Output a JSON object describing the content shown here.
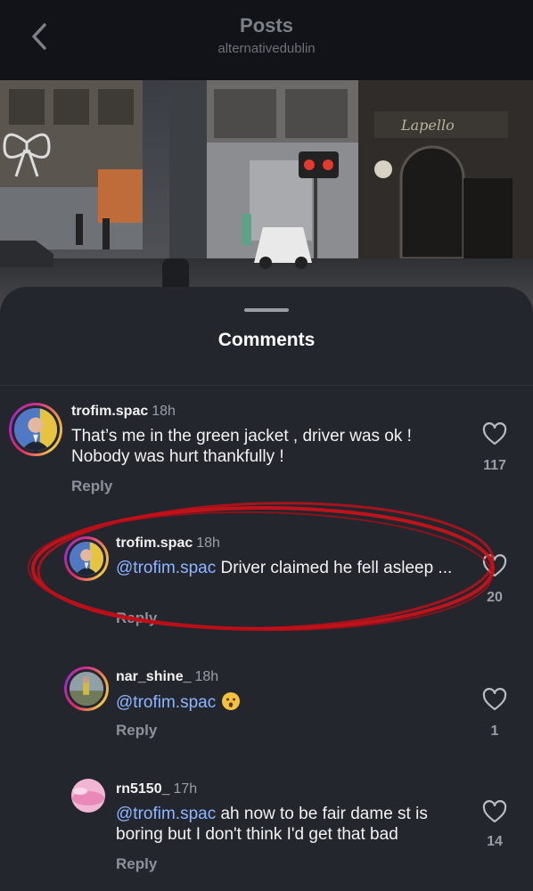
{
  "header": {
    "title": "Posts",
    "subtitle": "alternativedublin"
  },
  "photo": {
    "shop_sign": "Lapello"
  },
  "sheet": {
    "title": "Comments"
  },
  "comments": [
    {
      "username": "trofim.spac",
      "time": "18h",
      "text": "That’s me in the green jacket , driver was ok ! Nobody was hurt thankfully !",
      "mention": "",
      "reply_label": "Reply",
      "likes": "117"
    },
    {
      "username": "trofim.spac",
      "time": "18h",
      "mention": "@trofim.spac",
      "text": " Driver claimed he fell asleep ...",
      "reply_label": "Reply",
      "likes": "20"
    },
    {
      "username": "nar_shine_",
      "time": "18h",
      "mention": "@trofim.spac",
      "text": "",
      "emoji": "hushed-face-emoji",
      "reply_label": "Reply",
      "likes": "1"
    },
    {
      "username": "rn5150_",
      "time": "17h",
      "mention": "@trofim.spac",
      "text": " ah now to be fair dame st is boring but I don't think I'd get that bad",
      "reply_label": "Reply",
      "likes": "14"
    }
  ],
  "icons": {
    "back": "chevron-left-icon",
    "like": "heart-icon"
  },
  "colors": {
    "mention": "#8fb5ff",
    "annotation": "#d0121b",
    "sheet_bg": "#24262d"
  }
}
